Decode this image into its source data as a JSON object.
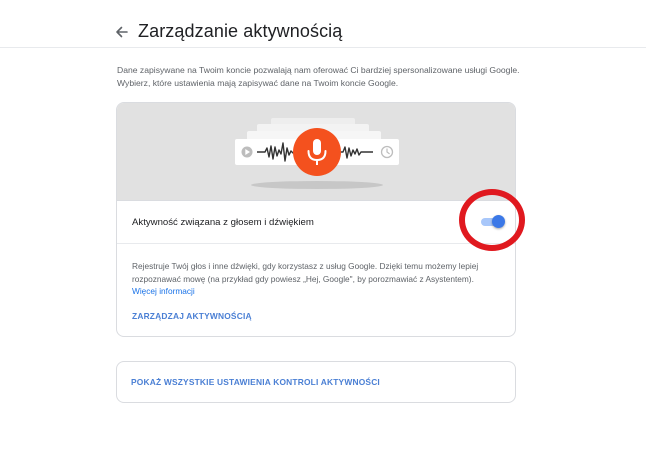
{
  "header": {
    "title": "Zarządzanie aktywnością",
    "back_icon": "arrow-back-icon"
  },
  "intro": {
    "text": "Dane zapisywane na Twoim koncie pozwalają nam oferować Ci bardziej spersonalizowane usługi Google. Wybierz, które ustawienia mają zapisywać dane na Twoim koncie Google."
  },
  "voice_card": {
    "illustration_icon": "microphone-icon",
    "toggle_label": "Aktywność związana z głosem i dźwiękiem",
    "toggle_on": true,
    "description": "Rejestruje Twój głos i inne dźwięki, gdy korzystasz z usług Google. Dzięki temu możemy lepiej rozpoznawać mowę (na przykład gdy powiesz „Hej, Google\", by porozmawiać z Asystentem).",
    "more_info_link": "Więcej informacji",
    "manage_label": "ZARZĄDZAJ AKTYWNOŚCIĄ"
  },
  "all_settings": {
    "label": "POKAŻ WSZYSTKIE USTAWIENIA KONTROLI AKTYWNOŚCI"
  },
  "colors": {
    "accent": "#1a73e8",
    "mic_orange": "#f4511e",
    "toggle_blue": "#3b78e7",
    "annotation_red": "#e0191f",
    "illustration_bg": "#e1e1e1"
  }
}
